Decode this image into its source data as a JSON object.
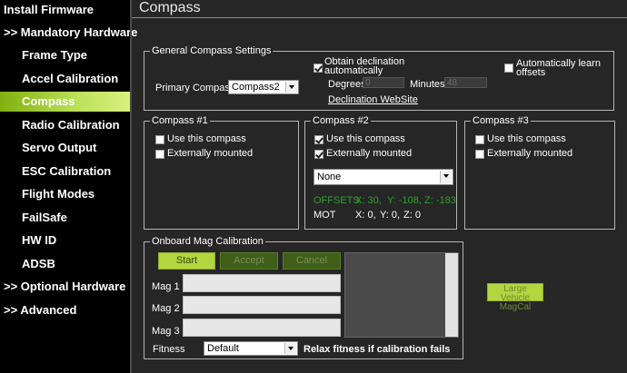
{
  "sidebar": {
    "items": [
      {
        "label": "Install Firmware",
        "kind": "top"
      },
      {
        "label": ">> Mandatory Hardware",
        "kind": "top"
      },
      {
        "label": "Frame Type",
        "kind": "sub"
      },
      {
        "label": "Accel Calibration",
        "kind": "sub"
      },
      {
        "label": "Compass",
        "kind": "sub",
        "active": true
      },
      {
        "label": "Radio Calibration",
        "kind": "sub"
      },
      {
        "label": "Servo Output",
        "kind": "sub"
      },
      {
        "label": "ESC Calibration",
        "kind": "sub"
      },
      {
        "label": "Flight Modes",
        "kind": "sub"
      },
      {
        "label": "FailSafe",
        "kind": "sub"
      },
      {
        "label": "HW ID",
        "kind": "sub"
      },
      {
        "label": "ADSB",
        "kind": "sub"
      },
      {
        "label": ">> Optional Hardware",
        "kind": "top"
      },
      {
        "label": ">> Advanced",
        "kind": "top"
      }
    ]
  },
  "page": {
    "title": "Compass"
  },
  "general": {
    "label": "General Compass Settings",
    "primary_label": "Primary Compass:",
    "primary_value": "Compass2",
    "obtain_decl_line1": "Obtain declination",
    "obtain_decl_line2": "automatically",
    "obtain_decl_checked": true,
    "degrees_label": "Degrees",
    "degrees_value": "0",
    "minutes_label": "Minutes",
    "minutes_value": "48",
    "decl_link": "Declination WebSite",
    "auto_learn_line1": "Automatically learn",
    "auto_learn_line2": "offsets",
    "auto_learn_checked": false
  },
  "compass1": {
    "label": "Compass #1",
    "use_label": "Use this compass",
    "use_checked": false,
    "ext_label": "Externally mounted",
    "ext_checked": false
  },
  "compass2": {
    "label": "Compass #2",
    "use_label": "Use this compass",
    "use_checked": true,
    "ext_label": "Externally mounted",
    "ext_checked": true,
    "orientation_value": "None",
    "offsets_label": "OFFSETS",
    "offsets_x": "X: 30,",
    "offsets_y": "Y: -108,",
    "offsets_z": "Z: -183",
    "mot_label": "MOT",
    "mot_x": "X: 0,",
    "mot_y": "Y: 0,",
    "mot_z": "Z: 0",
    "offsets_color": "#2f9e2f"
  },
  "compass3": {
    "label": "Compass #3",
    "use_label": "Use this compass",
    "use_checked": false,
    "ext_label": "Externally mounted",
    "ext_checked": false
  },
  "onboard": {
    "label": "Onboard Mag Calibration",
    "start_label": "Start",
    "accept_label": "Accept",
    "cancel_label": "Cancel",
    "mag1_label": "Mag 1",
    "mag2_label": "Mag 2",
    "mag3_label": "Mag 3",
    "fitness_label": "Fitness",
    "fitness_value": "Default",
    "relax_label": "Relax fitness if calibration fails"
  },
  "large_vehicle": {
    "line1": "Large Vehicle",
    "line2": "MagCal"
  },
  "colors": {
    "accent": "#b2d640",
    "sidebar_bg": "#000000",
    "main_bg": "#262626"
  }
}
